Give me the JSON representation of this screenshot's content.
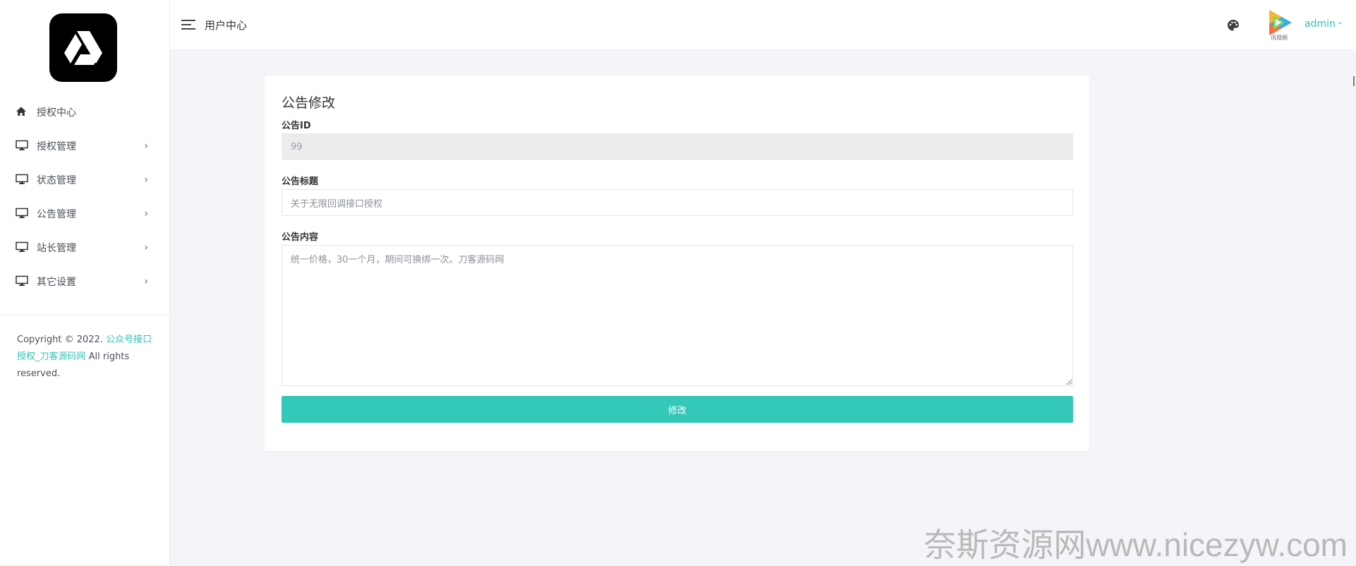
{
  "app": {
    "logo_icon": "drive-triangle-logo"
  },
  "sidebar": {
    "items": [
      {
        "label": "授权中心",
        "icon": "home-icon",
        "chevron": ""
      },
      {
        "label": "授权管理",
        "icon": "monitor-icon",
        "chevron": "›"
      },
      {
        "label": "状态管理",
        "icon": "monitor-icon",
        "chevron": "›"
      },
      {
        "label": "公告管理",
        "icon": "monitor-icon",
        "chevron": "›"
      },
      {
        "label": "站长管理",
        "icon": "monitor-icon",
        "chevron": "›"
      },
      {
        "label": "其它设置",
        "icon": "monitor-icon",
        "chevron": "›"
      }
    ],
    "copyright_prefix": "Copyright © 2022.",
    "copyright_link": "公众号接口授权_刀客源码网",
    "copyright_suffix": "All rights reserved."
  },
  "header": {
    "title": "用户中心",
    "user_name": "admin",
    "user_chevron": "⌄",
    "avatar_text": "讯视频"
  },
  "form": {
    "title": "公告修改",
    "id_label": "公告ID",
    "id_value": "99",
    "title_label": "公告标题",
    "title_value": "关于无限回调接口授权",
    "content_label": "公告内容",
    "content_value": "统一价格，30一个月，期间可换绑一次。刀客源码网",
    "submit_label": "修改"
  },
  "watermark": "奈斯资源网www.nicezyw.com",
  "colors": {
    "accent": "#34c8b9",
    "link": "#2fc3b5",
    "sidebar_bg": "#ffffff",
    "page_bg": "#f4f5f8"
  }
}
